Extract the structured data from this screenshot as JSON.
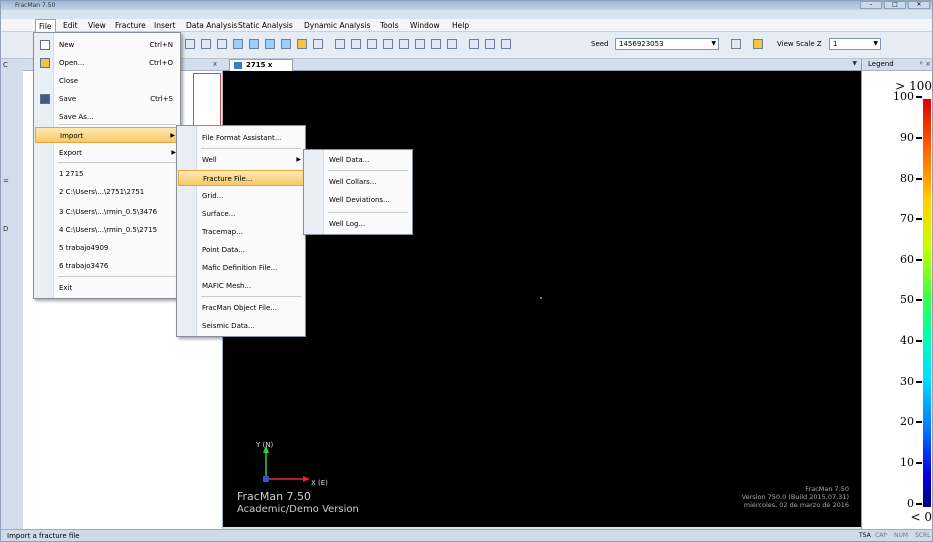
{
  "window": {
    "title": "FracMan 7.50"
  },
  "menubar": [
    "File",
    "Edit",
    "View",
    "Fracture",
    "Insert",
    "Data Analysis",
    "Static Analysis",
    "Dynamic Analysis",
    "Tools",
    "Window",
    "Help"
  ],
  "toolbar": {
    "seed_label": "Seed",
    "seed_value": "1456923053",
    "view_scale_label": "View Scale Z",
    "view_scale_value": "1"
  },
  "left_panel": {
    "header_close": "x"
  },
  "doc_tab": {
    "label": "2715",
    "close": "x"
  },
  "viewport": {
    "y_axis_label": "Y (N)",
    "x_axis_label": "X (E)",
    "product": "FracMan 7.50",
    "edition": "Academic/Demo Version",
    "version_lines": [
      "FracMan 7.50",
      "Version 750.0 (Build 2015.07.31)",
      "miércoles, 02 de marzo de 2016"
    ]
  },
  "legend": {
    "title": "Legend",
    "top_label": "> 100",
    "bottom_label": "< 0",
    "ticks": [
      "100",
      "90",
      "80",
      "70",
      "60",
      "50",
      "40",
      "30",
      "20",
      "10",
      "0"
    ]
  },
  "file_menu": {
    "items": [
      {
        "label": "New",
        "shortcut": "Ctrl+N",
        "icon": "new-file-icon"
      },
      {
        "label": "Open...",
        "shortcut": "Ctrl+O",
        "icon": "open-folder-icon"
      },
      {
        "label": "Close",
        "shortcut": ""
      },
      {
        "label": "Save",
        "shortcut": "Ctrl+S",
        "icon": "save-disk-icon"
      },
      {
        "label": "Save As...",
        "shortcut": ""
      },
      {
        "label": "Import",
        "shortcut": "",
        "submenu": true,
        "highlighted": true
      },
      {
        "label": "Export",
        "shortcut": "",
        "submenu": true
      },
      {
        "label": "1 2715",
        "shortcut": ""
      },
      {
        "label": "2 C:\\Users\\...\\2751\\2751",
        "shortcut": ""
      },
      {
        "label": "3 C:\\Users\\...\\rmin_0.5\\3476",
        "shortcut": ""
      },
      {
        "label": "4 C:\\Users\\...\\rmin_0.5\\2715",
        "shortcut": ""
      },
      {
        "label": "5 trabajo4909",
        "shortcut": ""
      },
      {
        "label": "6 trabajo3476",
        "shortcut": ""
      },
      {
        "label": "Exit",
        "shortcut": ""
      }
    ]
  },
  "import_menu": {
    "items": [
      {
        "label": "File Format Assistant..."
      },
      {
        "label": "Well",
        "submenu": true
      },
      {
        "label": "Fracture File...",
        "highlighted": true
      },
      {
        "label": "Grid..."
      },
      {
        "label": "Surface..."
      },
      {
        "label": "Tracemap..."
      },
      {
        "label": "Point Data..."
      },
      {
        "label": "Mafic Definition File..."
      },
      {
        "label": "MAFIC Mesh..."
      },
      {
        "label": "FracMan Object File..."
      },
      {
        "label": "Seismic Data..."
      }
    ]
  },
  "well_menu": {
    "items": [
      {
        "label": "Well Data..."
      },
      {
        "label": "Well Collars..."
      },
      {
        "label": "Well Deviations..."
      },
      {
        "label": "Well Log..."
      }
    ]
  },
  "statusbar": {
    "text": "Import a fracture file",
    "indicators": [
      "TSA",
      "CAP",
      "NUM",
      "SCRL"
    ]
  }
}
